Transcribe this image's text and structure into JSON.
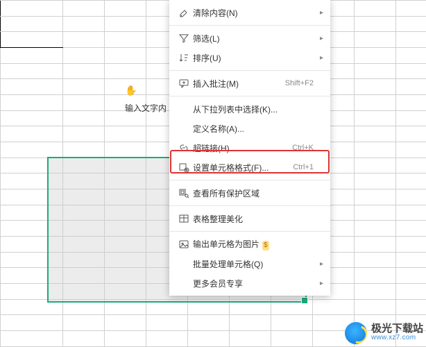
{
  "hint": {
    "icon": "✋",
    "text": "输入文字内"
  },
  "menu": {
    "clear": {
      "label": "清除内容(N)"
    },
    "filter": {
      "label": "筛选(L)"
    },
    "sort": {
      "label": "排序(U)"
    },
    "comment": {
      "label": "插入批注(M)",
      "shortcut": "Shift+F2"
    },
    "dropdown": {
      "label": "从下拉列表中选择(K)..."
    },
    "define_name": {
      "label": "定义名称(A)..."
    },
    "hyperlink": {
      "label": "超链接(H)...",
      "shortcut": "Ctrl+K"
    },
    "format_cells": {
      "label": "设置单元格格式(F)...",
      "shortcut": "Ctrl+1"
    },
    "view_protect": {
      "label": "查看所有保护区域"
    },
    "table_beautify": {
      "label": "表格整理美化"
    },
    "export_image": {
      "label": "输出单元格为图片",
      "vip": "$"
    },
    "batch_process": {
      "label": "批量处理单元格(Q)"
    },
    "more_vip": {
      "label": "更多会员专享"
    }
  },
  "watermark": {
    "zh": "极光下载站",
    "en": "www.xz7.com"
  }
}
